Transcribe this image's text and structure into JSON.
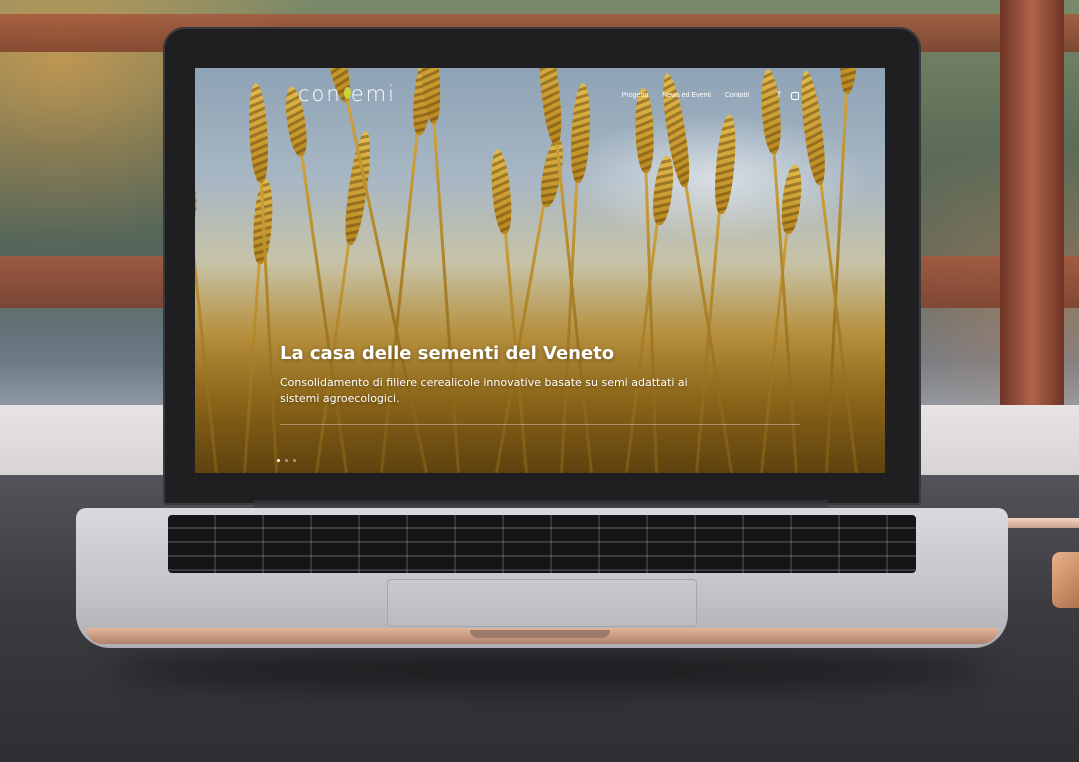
{
  "site": {
    "logo_text": "con",
    "logo_text_tail": "emi"
  },
  "nav": {
    "items": [
      "Progetto",
      "News ed Eventi",
      "Contatti"
    ]
  },
  "social": {
    "facebook_glyph": "f",
    "icons": [
      "facebook-icon",
      "instagram-icon"
    ]
  },
  "hero": {
    "title": "La casa delle sementi del Veneto",
    "subtitle": "Consolidamento di filiere cerealicole innovative basate su semi adattati ai sistemi agroecologici.",
    "slides": 3,
    "active_slide": 1
  },
  "colors": {
    "accent_seed": "#c9d23a",
    "text": "#ffffff"
  }
}
